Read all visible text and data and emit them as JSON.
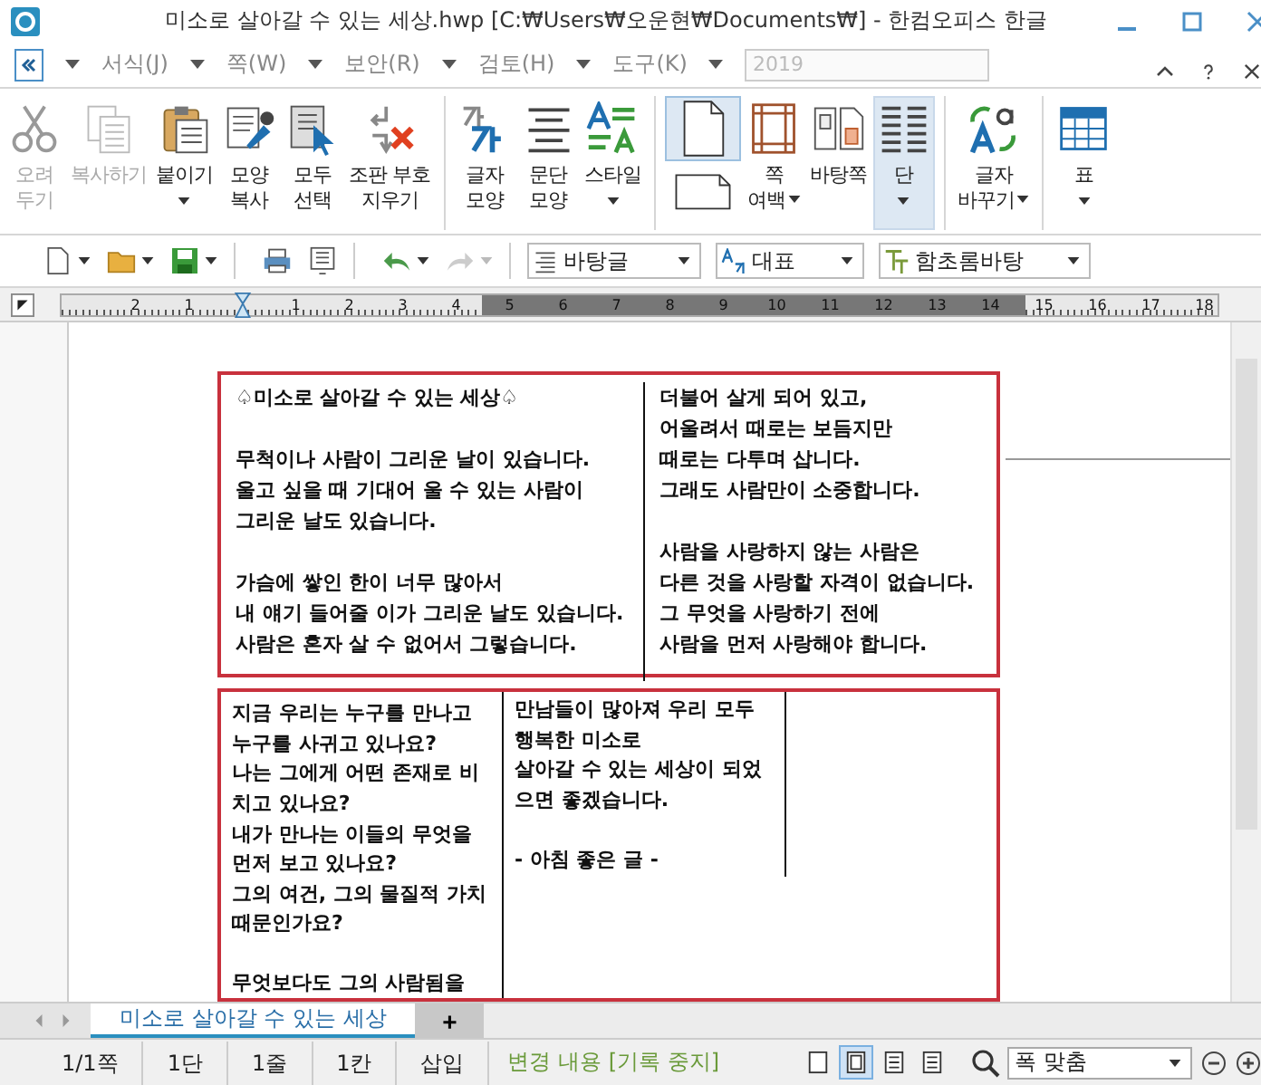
{
  "window": {
    "title": "미소로 살아갈 수 있는 세상.hwp [C:₩Users₩오운현₩Documents₩] - 한컴오피스 한글"
  },
  "menu": {
    "items": [
      {
        "label": "서식(J)"
      },
      {
        "label": "쪽(W)"
      },
      {
        "label": "보안(R)"
      },
      {
        "label": "검토(H)"
      },
      {
        "label": "도구(K)"
      }
    ],
    "year": {
      "value": "2019",
      "disabled": true
    }
  },
  "ribbon": {
    "groups": [
      [
        {
          "kind": "button",
          "label": "오려\n두기",
          "disabled": true
        },
        {
          "kind": "button",
          "label": "복사하기",
          "disabled": true
        },
        {
          "kind": "button",
          "label": "붙이기",
          "disabled": false,
          "dropdown": true
        },
        {
          "kind": "button",
          "label": "모양\n복사",
          "disabled": false
        },
        {
          "kind": "button",
          "label": "모두\n선택",
          "disabled": false
        },
        {
          "kind": "button",
          "label": "조판 부호\n지우기",
          "disabled": false
        }
      ],
      [
        {
          "kind": "button",
          "label": "글자\n모양",
          "disabled": false
        },
        {
          "kind": "button",
          "label": "문단\n모양",
          "disabled": false
        },
        {
          "kind": "button",
          "label": "스타일",
          "disabled": false,
          "dropdown": true
        }
      ],
      [
        {
          "kind": "orientation",
          "options": [
            {
              "selected": true
            },
            {
              "selected": false
            }
          ]
        },
        {
          "kind": "button",
          "label": "쪽\n여백",
          "disabled": false,
          "dropdown": true
        },
        {
          "kind": "button",
          "label": "바탕쪽",
          "disabled": false
        },
        {
          "kind": "button",
          "label": "단",
          "disabled": false,
          "dropdown": true,
          "selected": true
        }
      ],
      [
        {
          "kind": "button",
          "label": "글자\n바꾸기",
          "disabled": false,
          "dropdown": true
        }
      ],
      [
        {
          "kind": "button",
          "label": "표",
          "disabled": false,
          "dropdown": true
        }
      ]
    ]
  },
  "toolbar": {
    "dropdowns": [
      {
        "value": "바탕글"
      },
      {
        "value": "대표"
      },
      {
        "value": "함초롬바탕"
      }
    ]
  },
  "ruler": {
    "labels": [
      "2",
      "1",
      "1",
      "2",
      "3",
      "4",
      "5",
      "6",
      "7",
      "8",
      "9",
      "10",
      "11",
      "12",
      "13",
      "14",
      "15",
      "16",
      "17",
      "18"
    ]
  },
  "document": {
    "boxes": [
      {
        "columns": [
          {
            "paragraphs": [
              [
                "♤미소로 살아갈 수 있는 세상♤"
              ],
              [
                "무척이나 사람이 그리운 날이 있습니다.",
                "울고 싶을 때 기대어 울 수 있는 사람이",
                "그리운 날도 있습니다."
              ],
              [
                "가슴에 쌓인 한이 너무 많아서",
                "내 얘기 들어줄 이가 그리운 날도 있습니다.",
                "사람은 혼자 살 수 없어서 그렇습니다."
              ]
            ]
          },
          {
            "paragraphs": [
              [
                "더불어 살게 되어 있고,",
                "어울려서 때로는 보듬지만",
                "때로는 다투며 삽니다.",
                "그래도 사람만이 소중합니다."
              ],
              [
                "사람을 사랑하지 않는 사람은",
                "다른 것을 사랑할 자격이 없습니다.",
                "그 무엇을 사랑하기 전에",
                "사람을 먼저 사랑해야 합니다."
              ]
            ]
          }
        ]
      },
      {
        "columns": [
          {
            "paragraphs": [
              [
                "지금 우리는 누구를 만나고",
                "누구를 사귀고 있나요?",
                "나는 그에게 어떤 존재로 비",
                "치고 있나요?",
                "내가 만나는 이들의 무엇을",
                "먼저 보고 있나요?",
                "그의 여건, 그의 물질적 가치",
                "때문인가요?"
              ],
              [
                "무엇보다도 그의 사람됨을"
              ]
            ]
          },
          {
            "paragraphs": [
              [
                "만남들이 많아져 우리 모두",
                "행복한 미소로",
                "살아갈 수 있는 세상이 되었",
                "으면 좋겠습니다."
              ],
              [
                "- 아침 좋은 글 -"
              ]
            ]
          }
        ]
      }
    ]
  },
  "tabs": [
    {
      "label": "미소로 살아갈 수 있는 세상",
      "selected": true
    }
  ],
  "new_tab": "+",
  "status_bar": {
    "items": [
      "1/1쪽",
      "1단",
      "1줄",
      "1칸",
      "삽입"
    ],
    "track_changes": "변경 내용 [기록 중지]",
    "view_modes": [
      {
        "selected": false
      },
      {
        "selected": true
      },
      {
        "selected": false
      },
      {
        "selected": false
      }
    ],
    "zoom": "폭 맞춤"
  }
}
